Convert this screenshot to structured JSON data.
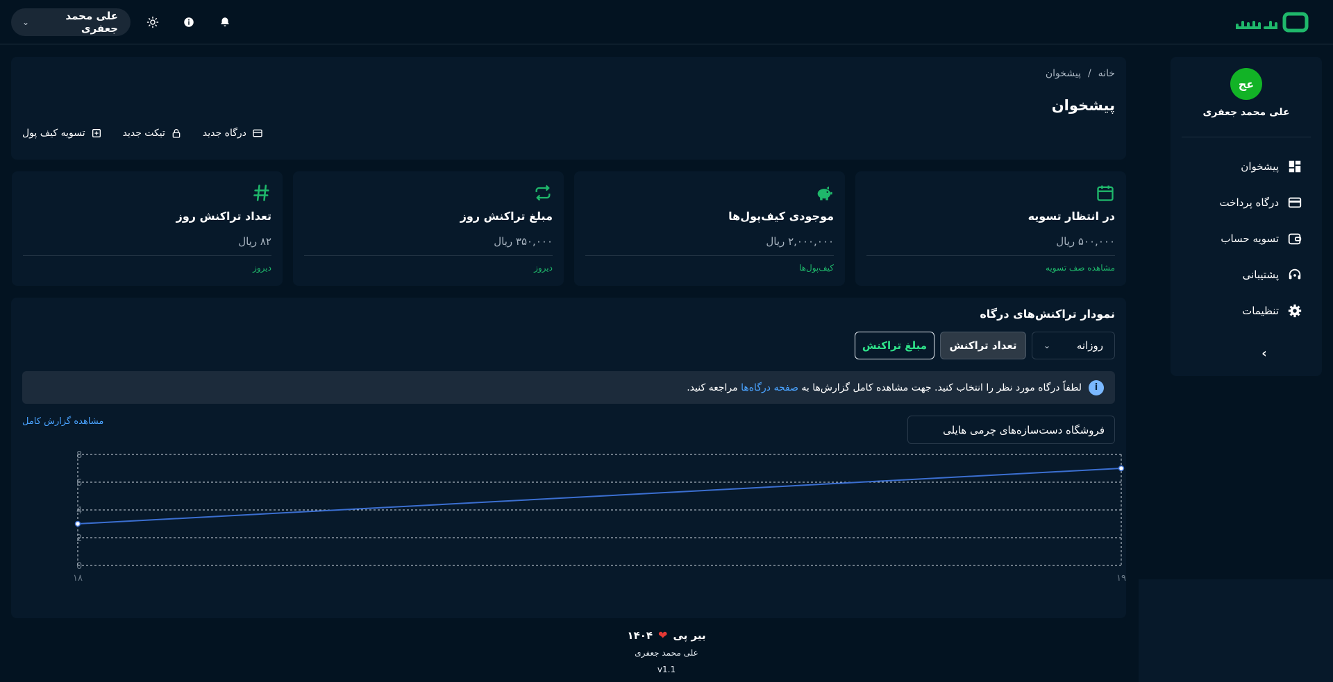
{
  "header": {
    "user_name": "علی محمد جعفری",
    "icons": [
      "bell-icon",
      "info-icon",
      "sun-icon",
      "chevron-down-icon"
    ]
  },
  "sidebar": {
    "avatar_initials": "عج",
    "user_name": "علی محمد جعفری",
    "items": [
      {
        "label": "پیشخوان",
        "icon": "dashboard-icon"
      },
      {
        "label": "درگاه پرداخت",
        "icon": "credit-card-icon"
      },
      {
        "label": "تسویه حساب",
        "icon": "wallet-icon"
      },
      {
        "label": "پشتیبانی",
        "icon": "headset-icon"
      },
      {
        "label": "تنظیمات",
        "icon": "gear-icon"
      }
    ]
  },
  "breadcrumb": {
    "home": "خانه",
    "separator": "/",
    "current": "پیشخوان"
  },
  "page_title": "پیشخوان",
  "quick_actions": {
    "new_gateway": "درگاه جدید",
    "new_ticket": "تیکت جدید",
    "wallet_settlement": "تسویه کیف پول"
  },
  "stats": [
    {
      "title": "در انتظار تسویه",
      "value": "۵۰۰,۰۰۰ ریال",
      "link": "مشاهده صف تسویه",
      "icon": "calendar-icon"
    },
    {
      "title": "موجودی کیف‌پول‌ها",
      "value": "۲,۰۰۰,۰۰۰ ریال",
      "link": "کیف‌پول‌ها",
      "icon": "piggy-bank-icon"
    },
    {
      "title": "مبلغ تراکنش روز",
      "value": "۳۵۰,۰۰۰ ریال",
      "link": "دیروز",
      "icon": "repeat-icon"
    },
    {
      "title": "تعداد تراکنش روز",
      "value": "۸۲ ریال",
      "link": "دیروز",
      "icon": "hash-icon"
    }
  ],
  "chart_section": {
    "title": "نمودار تراکنش‌های درگاه",
    "period_select": "روزانه",
    "btn_count": "تعداد تراکنش",
    "btn_amount": "مبلغ تراکنش",
    "info_text": "لطفاً درگاه مورد نظر را انتخاب کنید. جهت مشاهده کامل گزارش‌ها به",
    "info_link": "صفحه درگاه‌ها",
    "info_suffix": "مراجعه کنید.",
    "full_report": "مشاهده گزارش کامل",
    "gateway_select": "فروشگاه دست‌سازه‌های چرمی هایلی"
  },
  "chart_data": {
    "type": "line",
    "x": [
      "۱۸",
      "۱۹"
    ],
    "series": [
      {
        "values": [
          3,
          7
        ]
      }
    ],
    "ylim": [
      0,
      8
    ],
    "yticks": [
      0,
      2,
      4,
      6,
      8
    ],
    "grid": true,
    "color": "#3b6fd1"
  },
  "footer": {
    "year": "۱۴۰۴",
    "brand": "بیر پی",
    "author": "علی محمد جعفری",
    "version": "v1.1"
  },
  "colors": {
    "accent_green": "#1fb86b",
    "link_blue": "#4aa3ff",
    "avatar_green": "#12b326",
    "background": "#031321"
  }
}
